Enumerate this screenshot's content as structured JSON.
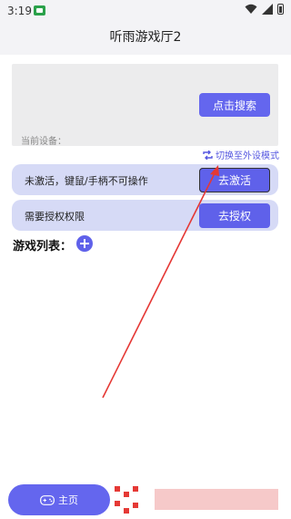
{
  "status_bar": {
    "time": "3:19"
  },
  "header": {
    "title": "听雨游戏厅2"
  },
  "device_panel": {
    "search_label": "点击搜索",
    "device_label": "当前设备："
  },
  "switch_mode": {
    "label": "切换至外设模式"
  },
  "status_rows": [
    {
      "text": "未激活，键鼠/手柄不可操作",
      "button": "去激活"
    },
    {
      "text": "需要授权权限",
      "button": "去授权"
    }
  ],
  "game_list": {
    "heading": "游戏列表："
  },
  "bottom_nav": {
    "home_label": "主页"
  },
  "colors": {
    "accent": "#6466ee",
    "row_bg": "#d6daf6",
    "arrow": "#e53935"
  }
}
